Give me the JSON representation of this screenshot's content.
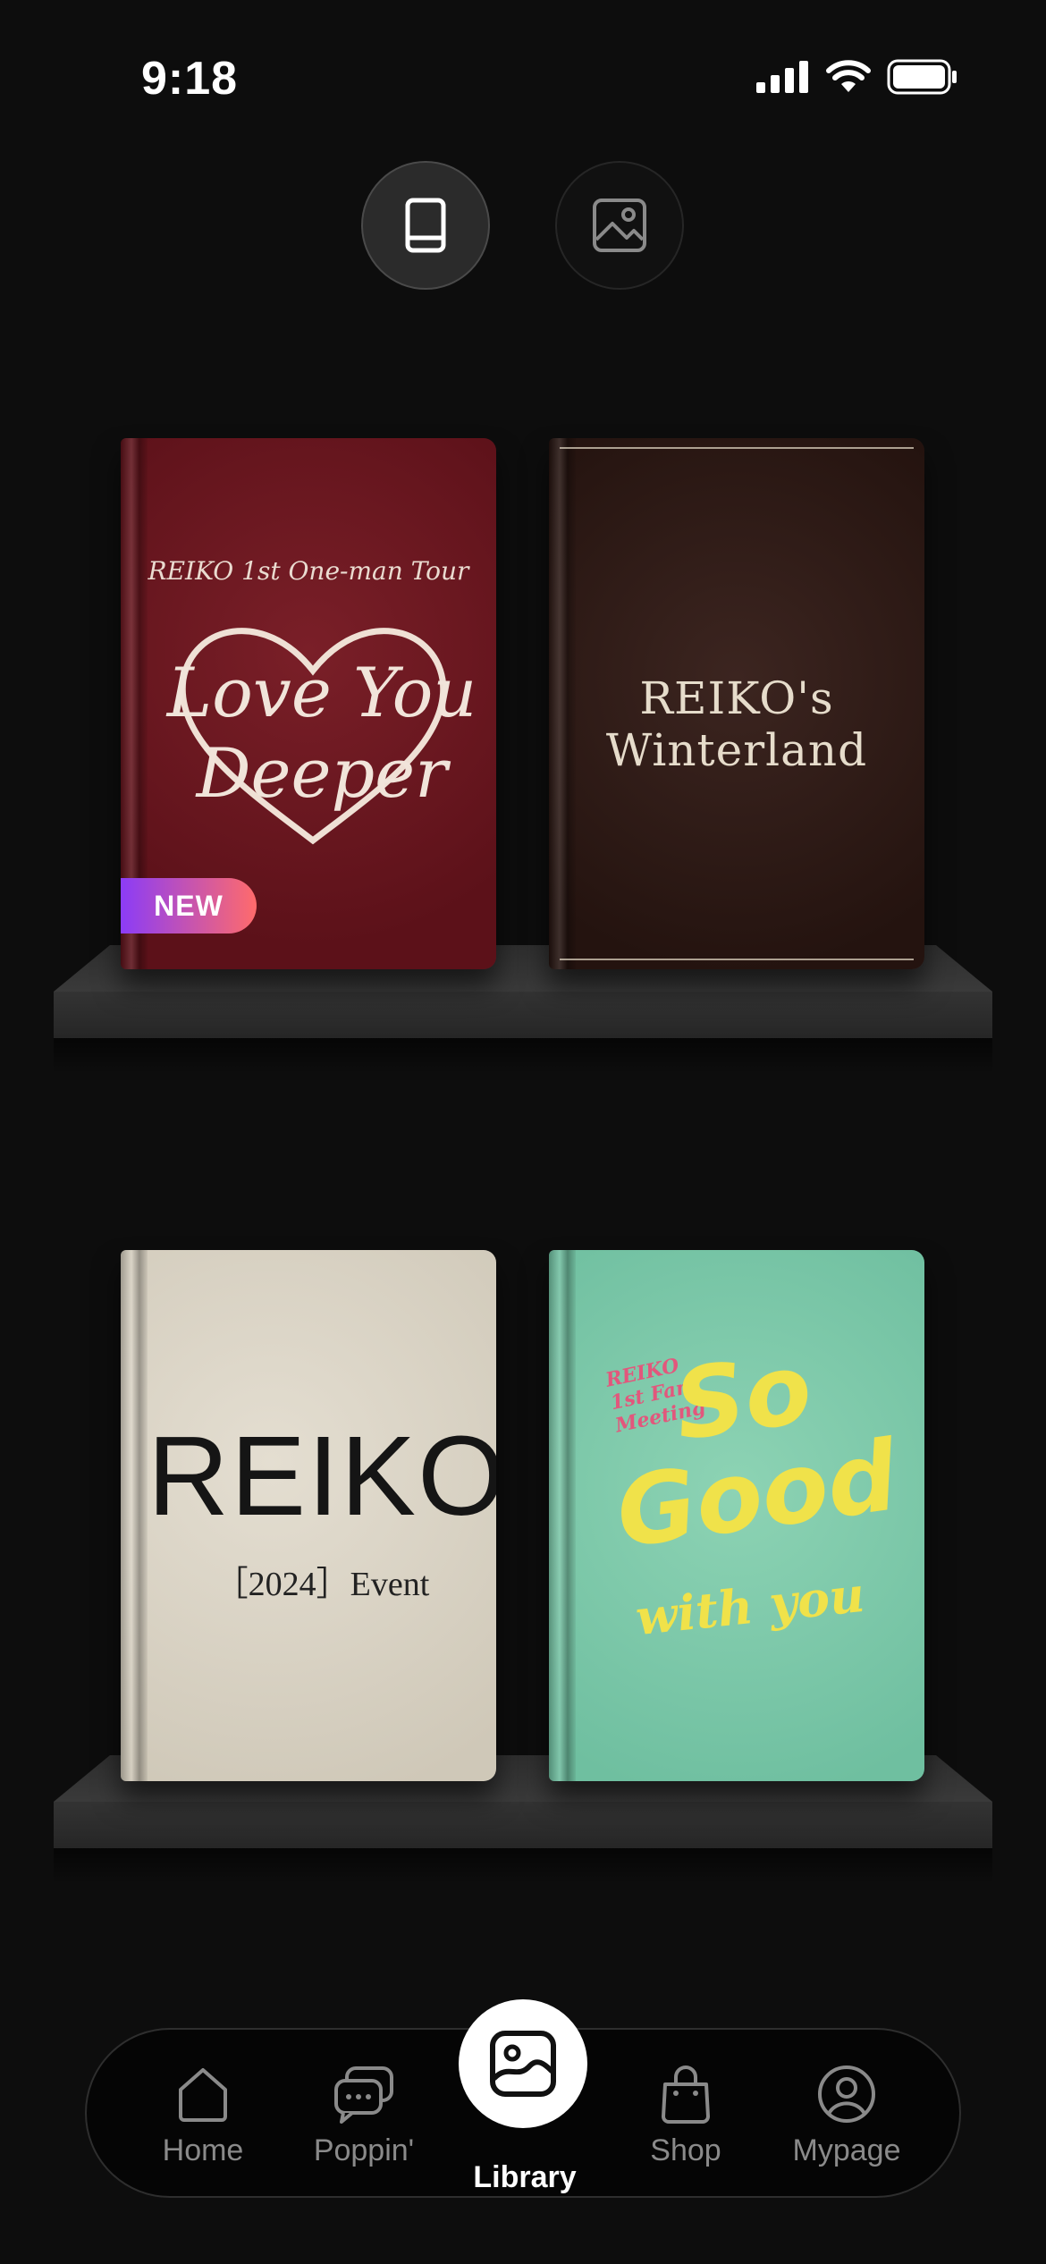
{
  "status_bar": {
    "time": "9:18"
  },
  "view_toggle": {
    "books_icon": "book-icon",
    "photos_icon": "image-icon"
  },
  "books": [
    {
      "subtitle": "REIKO 1st One-man Tour",
      "title_line1": "Love You",
      "title_line2": "Deeper",
      "badge": "NEW",
      "color": "#6b1620"
    },
    {
      "title": "REIKO's Winterland",
      "color": "#2e1a15"
    },
    {
      "title": "REIKO",
      "subtitle": "［2024］Event",
      "color": "#d9d2c3"
    },
    {
      "small": "REIKO 1st Fan Meeting",
      "title_line1": "So",
      "title_line2": "Good",
      "title_line3": "with you",
      "color": "#7cc9aa"
    }
  ],
  "tabbar": {
    "items": [
      {
        "label": "Home",
        "icon": "home-icon"
      },
      {
        "label": "Poppin'",
        "icon": "chat-bubbles-icon"
      },
      {
        "label": "Library",
        "icon": "photo-icon",
        "active": true
      },
      {
        "label": "Shop",
        "icon": "shopping-bag-icon"
      },
      {
        "label": "Mypage",
        "icon": "user-circle-icon"
      }
    ]
  }
}
